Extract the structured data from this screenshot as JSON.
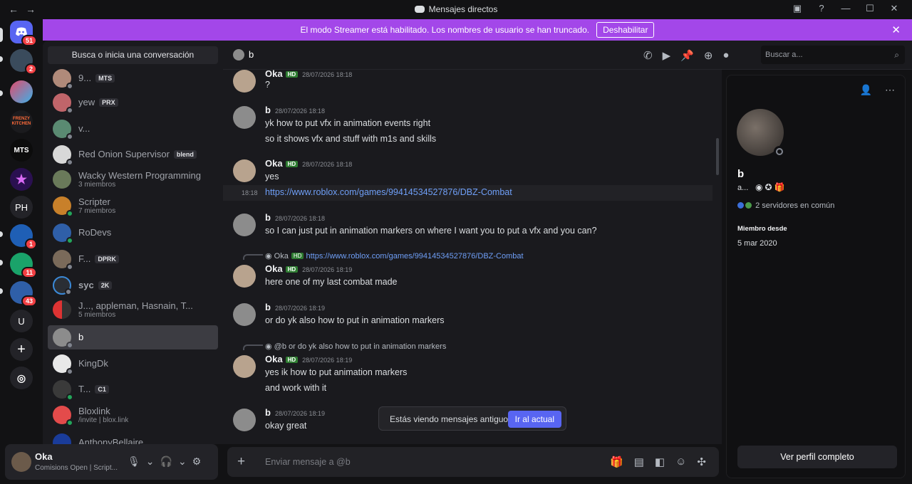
{
  "window": {
    "title": "Mensajes directos",
    "nav_back": "←",
    "nav_forward": "→"
  },
  "guild_badges": {
    "home": "51",
    "g1": "2",
    "g5": "1",
    "g6": "11",
    "g7": "43"
  },
  "guild_labels": {
    "mts": "MTS",
    "ph": "PH",
    "u": "U",
    "frenzy": "FRENZY KITCHEN"
  },
  "banner": {
    "text": "El modo Streamer está habilitado. Los nombres de usuario se han truncado.",
    "button": "Deshabilitar"
  },
  "dm_list": {
    "search": "Busca o inicia una conversación",
    "items": [
      {
        "name": "9...",
        "tag": "MTS",
        "sub": ""
      },
      {
        "name": "yew",
        "tag": "PRX",
        "sub": ""
      },
      {
        "name": "v...",
        "tag": "",
        "sub": ""
      },
      {
        "name": "Red Onion Supervisor",
        "tag": "blend",
        "sub": ""
      },
      {
        "name": "Wacky Western Programming",
        "tag": "",
        "sub": "3 miembros"
      },
      {
        "name": "Scripter",
        "tag": "",
        "sub": "7 miembros"
      },
      {
        "name": "RoDevs",
        "tag": "",
        "sub": ""
      },
      {
        "name": "F...",
        "tag": "DPRK",
        "sub": ""
      },
      {
        "name": "syc",
        "tag": "2K",
        "sub": ""
      },
      {
        "name": "J..., appleman, Hasnain, T...",
        "tag": "",
        "sub": "5 miembros"
      },
      {
        "name": "b",
        "tag": "",
        "sub": ""
      },
      {
        "name": "KingDk",
        "tag": "",
        "sub": ""
      },
      {
        "name": "T...",
        "tag": "C1",
        "sub": ""
      },
      {
        "name": "Bloxlink",
        "tag": "",
        "sub": "/invite | blox.link"
      },
      {
        "name": "AnthonyBellaire",
        "tag": "",
        "sub": ""
      }
    ]
  },
  "user_panel": {
    "name": "Oka",
    "status": "Comisions Open | Script..."
  },
  "chat": {
    "channel_name": "b",
    "search_placeholder": "Buscar a...",
    "messages": [
      {
        "author": "Oka",
        "time": "28/07/2026 18:18",
        "lines": [
          "?"
        ]
      },
      {
        "author": "b",
        "time": "28/07/2026 18:18",
        "lines": [
          "yk how to put vfx in animation events right",
          "so it shows vfx and stuff with m1s and skills"
        ]
      },
      {
        "author": "Oka",
        "time": "28/07/2026 18:18",
        "lines": [
          "yes"
        ],
        "hover_time": "18:18",
        "link": "https://www.roblox.com/games/99414534527876/DBZ-Combat"
      },
      {
        "author": "b",
        "time": "28/07/2026 18:18",
        "lines": [
          "so I can just put in animation markers on where I want you to put a vfx and you can?"
        ]
      },
      {
        "author": "Oka",
        "time": "28/07/2026 18:19",
        "lines": [
          "here one of my last combat made"
        ],
        "reply_author": "Oka",
        "reply_text": "https://www.roblox.com/games/99414534527876/DBZ-Combat"
      },
      {
        "author": "b",
        "time": "28/07/2026 18:19",
        "lines": [
          "or do yk also how to put in animation markers"
        ]
      },
      {
        "author": "Oka",
        "time": "28/07/2026 18:19",
        "lines": [
          "yes ik how to put animation markers",
          "and work with it"
        ],
        "reply_author": "@b",
        "reply_text": "or do yk also how to put in animation markers"
      },
      {
        "author": "b",
        "time": "28/07/2026 18:19",
        "lines": [
          "okay great"
        ]
      }
    ],
    "hd_tag": "HD",
    "toast": {
      "text": "Estás viendo mensajes antiguos",
      "button": "Ir al actual"
    },
    "composer_placeholder": "Enviar mensaje a @b"
  },
  "profile": {
    "name": "b",
    "sub": "a...",
    "mutual": "2 servidores en común",
    "member_since_label": "Miembro desde",
    "member_since": "5 mar 2020",
    "full_profile_button": "Ver perfil completo"
  },
  "colors": {
    "accent": "#5865f2",
    "banner": "#a347e9",
    "badge": "#f23f43",
    "link": "#6f9ff7"
  }
}
